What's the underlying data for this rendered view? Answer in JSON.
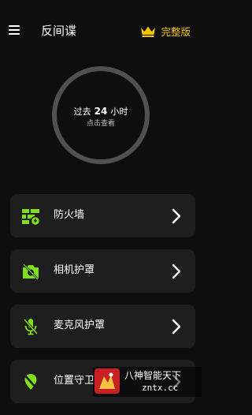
{
  "header": {
    "title": "反间谍",
    "premium_label": "完整版",
    "premium_color": "#f4c400",
    "menu_icon": "hamburger-menu-icon",
    "premium_icon": "crown-icon"
  },
  "summary": {
    "prefix": "过去",
    "hours": "24",
    "suffix": "小时",
    "subtitle": "点击查看"
  },
  "features": [
    {
      "label": "防火墙",
      "icon": "firewall-icon"
    },
    {
      "label": "相机护罩",
      "icon": "camera-blocked-icon"
    },
    {
      "label": "麦克风护罩",
      "icon": "microphone-muted-icon"
    },
    {
      "label": "位置守卫",
      "icon": "location-blocked-icon"
    }
  ],
  "accent_color": "#7fe01a",
  "watermark": {
    "line1": "八神智能天下",
    "line2": "zntx.cc"
  }
}
